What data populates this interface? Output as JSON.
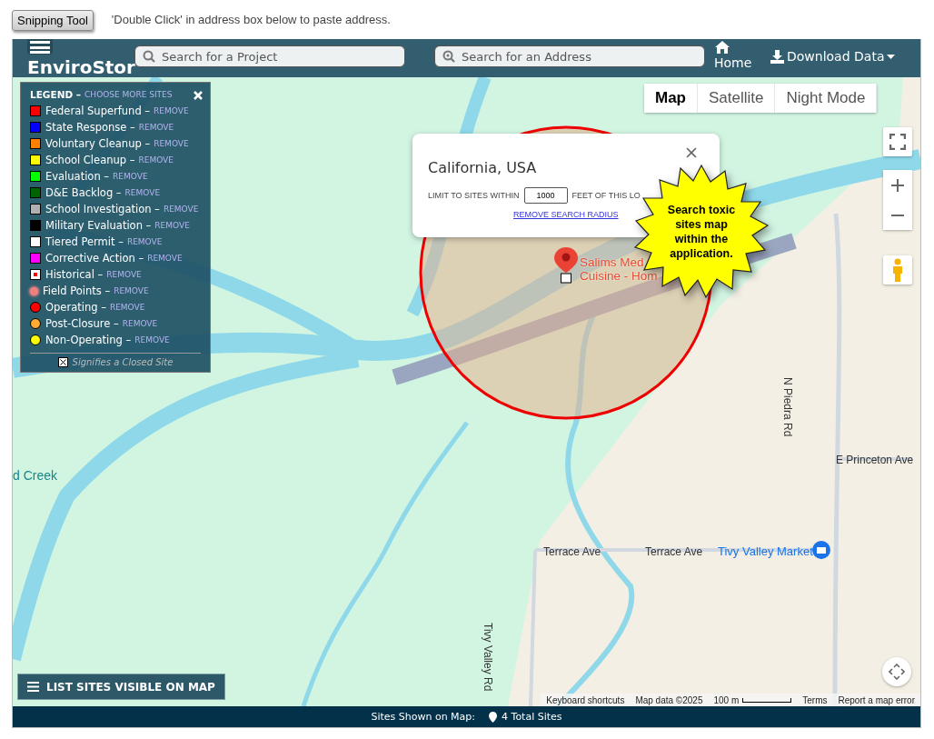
{
  "toolbar": {
    "button": "Snipping Tool",
    "hint": "'Double Click' in address box below to paste address."
  },
  "header": {
    "logo": "EnviroStor",
    "project_search": {
      "placeholder": "Search for a Project"
    },
    "address_search": {
      "placeholder": "Search for an Address"
    },
    "home": "Home",
    "download": "Download Data"
  },
  "legend": {
    "title": "LEGEND –",
    "link": "CHOOSE MORE SITES",
    "items": [
      {
        "label": "Federal Superfund –",
        "remove": "REMOVE",
        "kind": "square",
        "color": "#ff0000"
      },
      {
        "label": "State Response –",
        "remove": "REMOVE",
        "kind": "square",
        "color": "#0000ff"
      },
      {
        "label": "Voluntary Cleanup –",
        "remove": "REMOVE",
        "kind": "square",
        "color": "#ff7f00"
      },
      {
        "label": "School Cleanup –",
        "remove": "REMOVE",
        "kind": "square",
        "color": "#ffff00"
      },
      {
        "label": "Evaluation –",
        "remove": "REMOVE",
        "kind": "square",
        "color": "#00ff00"
      },
      {
        "label": "D&E Backlog –",
        "remove": "REMOVE",
        "kind": "square",
        "color": "#006400"
      },
      {
        "label": "School Investigation –",
        "remove": "REMOVE",
        "kind": "square",
        "color": "#b0b0b0"
      },
      {
        "label": "Military Evaluation –",
        "remove": "REMOVE",
        "kind": "square",
        "color": "#000000"
      },
      {
        "label": "Tiered Permit –",
        "remove": "REMOVE",
        "kind": "square",
        "color": "#ffffff"
      },
      {
        "label": "Corrective Action –",
        "remove": "REMOVE",
        "kind": "square",
        "color": "#ff00ff"
      },
      {
        "label": "Historical –",
        "remove": "REMOVE",
        "kind": "dot-square",
        "color": "#ff0000"
      },
      {
        "label": "Field Points –",
        "remove": "REMOVE",
        "kind": "glow",
        "color": "#f08080"
      },
      {
        "label": "Operating –",
        "remove": "REMOVE",
        "kind": "circle",
        "color": "#ff0000"
      },
      {
        "label": "Post-Closure –",
        "remove": "REMOVE",
        "kind": "circle",
        "color": "#ffaa33"
      },
      {
        "label": "Non-Operating –",
        "remove": "REMOVE",
        "kind": "circle",
        "color": "#ffff00"
      }
    ],
    "footnote": "Signifies a Closed Site"
  },
  "map_types": [
    {
      "label": "Map",
      "selected": true
    },
    {
      "label": "Satellite",
      "selected": false
    },
    {
      "label": "Night Mode",
      "selected": false
    }
  ],
  "popup": {
    "title": "California, USA",
    "limit_label": "LIMIT TO SITES WITHIN",
    "distance": "1000",
    "unit_label": "FEET OF THIS LO",
    "link": "REMOVE SEARCH RADIUS"
  },
  "callout": "Search toxic sites map within the application.",
  "marker_label": [
    "Salims Med",
    "Cuisine - Hom"
  ],
  "map_labels": [
    "d Creek",
    "E Princeton Ave",
    "Terrace Ave",
    "Terrace Ave",
    "Tivy Valley Market",
    "N Piedra Rd",
    "Tivy Valley Rd"
  ],
  "list_button": "LIST SITES VISIBLE ON MAP",
  "attribution": [
    "Keyboard shortcuts",
    "Map data ©2025",
    "100 m",
    "Terms",
    "Report a map error"
  ],
  "footer": {
    "label": "Sites Shown on Map:",
    "count": "4 Total Sites"
  }
}
